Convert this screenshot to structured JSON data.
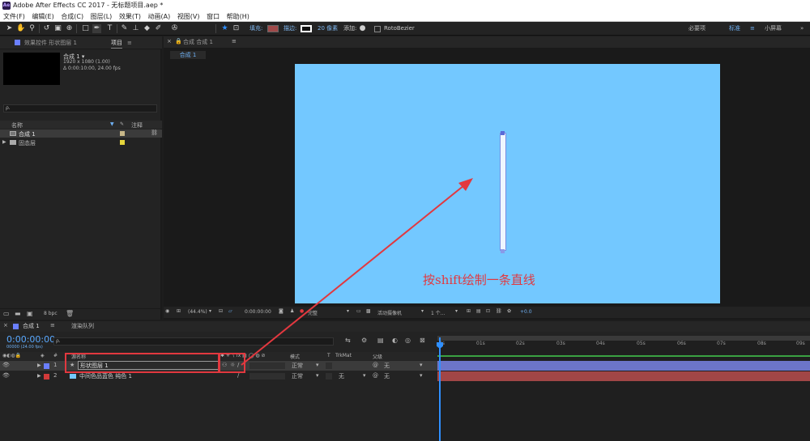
{
  "window": {
    "title": "Adobe After Effects CC 2017 - 无标题项目.aep *",
    "app_icon": "Ae"
  },
  "menu": [
    "文件(F)",
    "编辑(E)",
    "合成(C)",
    "图层(L)",
    "效果(T)",
    "动画(A)",
    "视图(V)",
    "窗口",
    "帮助(H)"
  ],
  "toolbar": {
    "fill_label": "填充:",
    "stroke_label": "描边:",
    "stroke_width": "20 像素",
    "add_label": "添加:",
    "roto_label": "RotoBezier",
    "workspaces": [
      "必要项",
      "标准",
      "小屏幕"
    ],
    "colors": {
      "fill": "#a04a4a",
      "accent": "#2f8fff"
    }
  },
  "left_panel": {
    "tab_effects": "效果控件 形状图层 1",
    "tab_project": "项目",
    "menu_icon": "≡",
    "comp_name": "合成 1 ▾",
    "comp_info_1": "1920 x 1080 (1.00)",
    "comp_info_2": "Δ 0:00:10:00, 24.00 fps",
    "search_icon": "ρ.",
    "col_name": "名称",
    "col_comment": "注释",
    "items": [
      {
        "name": "合成 1",
        "type": "comp",
        "label_color": "#c8b889"
      },
      {
        "name": "固态层",
        "type": "folder",
        "label_color": "#e6d63c"
      }
    ],
    "bottom_bpc": "8 bpc"
  },
  "viewer": {
    "tab_label": "合成 合成 1",
    "menu_icon": "≡",
    "subtab": "合成 1",
    "canvas_color": "#73c8ff",
    "annotation": "按shift绘制一条直线",
    "annotation_color": "#e2383f",
    "zoom": "(44.4%)",
    "timecode": "0:00:00:00",
    "resolution": "完整",
    "camera": "活动摄像机",
    "views": "1 个...",
    "exposure": "+0.0"
  },
  "timeline": {
    "tab_comp": "合成 1",
    "tab_render": "渲染队列",
    "timecode": "0:00:00:00",
    "fps_hint": "00000 (24.00 fps)",
    "search_icon": "ρ.",
    "headers": {
      "num": "#",
      "source": "源名称",
      "mode": "模式",
      "t": "T",
      "trkmat": "TrkMat",
      "parent": "父级"
    },
    "layers": [
      {
        "num": "1",
        "name": "形状图层 1",
        "icon": "★",
        "label_color": "#6a7fff",
        "mode": "正常",
        "trkmat": "",
        "parent": "无",
        "bar_color": "#6c75c8"
      },
      {
        "num": "2",
        "name": "中间色品蓝色 纯色 1",
        "icon": "■",
        "label_color": "#d23a3a",
        "mode": "正常",
        "trkmat": "无",
        "parent": "无",
        "bar_color": "#a14646"
      }
    ],
    "ruler": [
      "0s",
      "01s",
      "02s",
      "03s",
      "04s",
      "05s",
      "06s",
      "07s",
      "08s",
      "09s"
    ]
  }
}
